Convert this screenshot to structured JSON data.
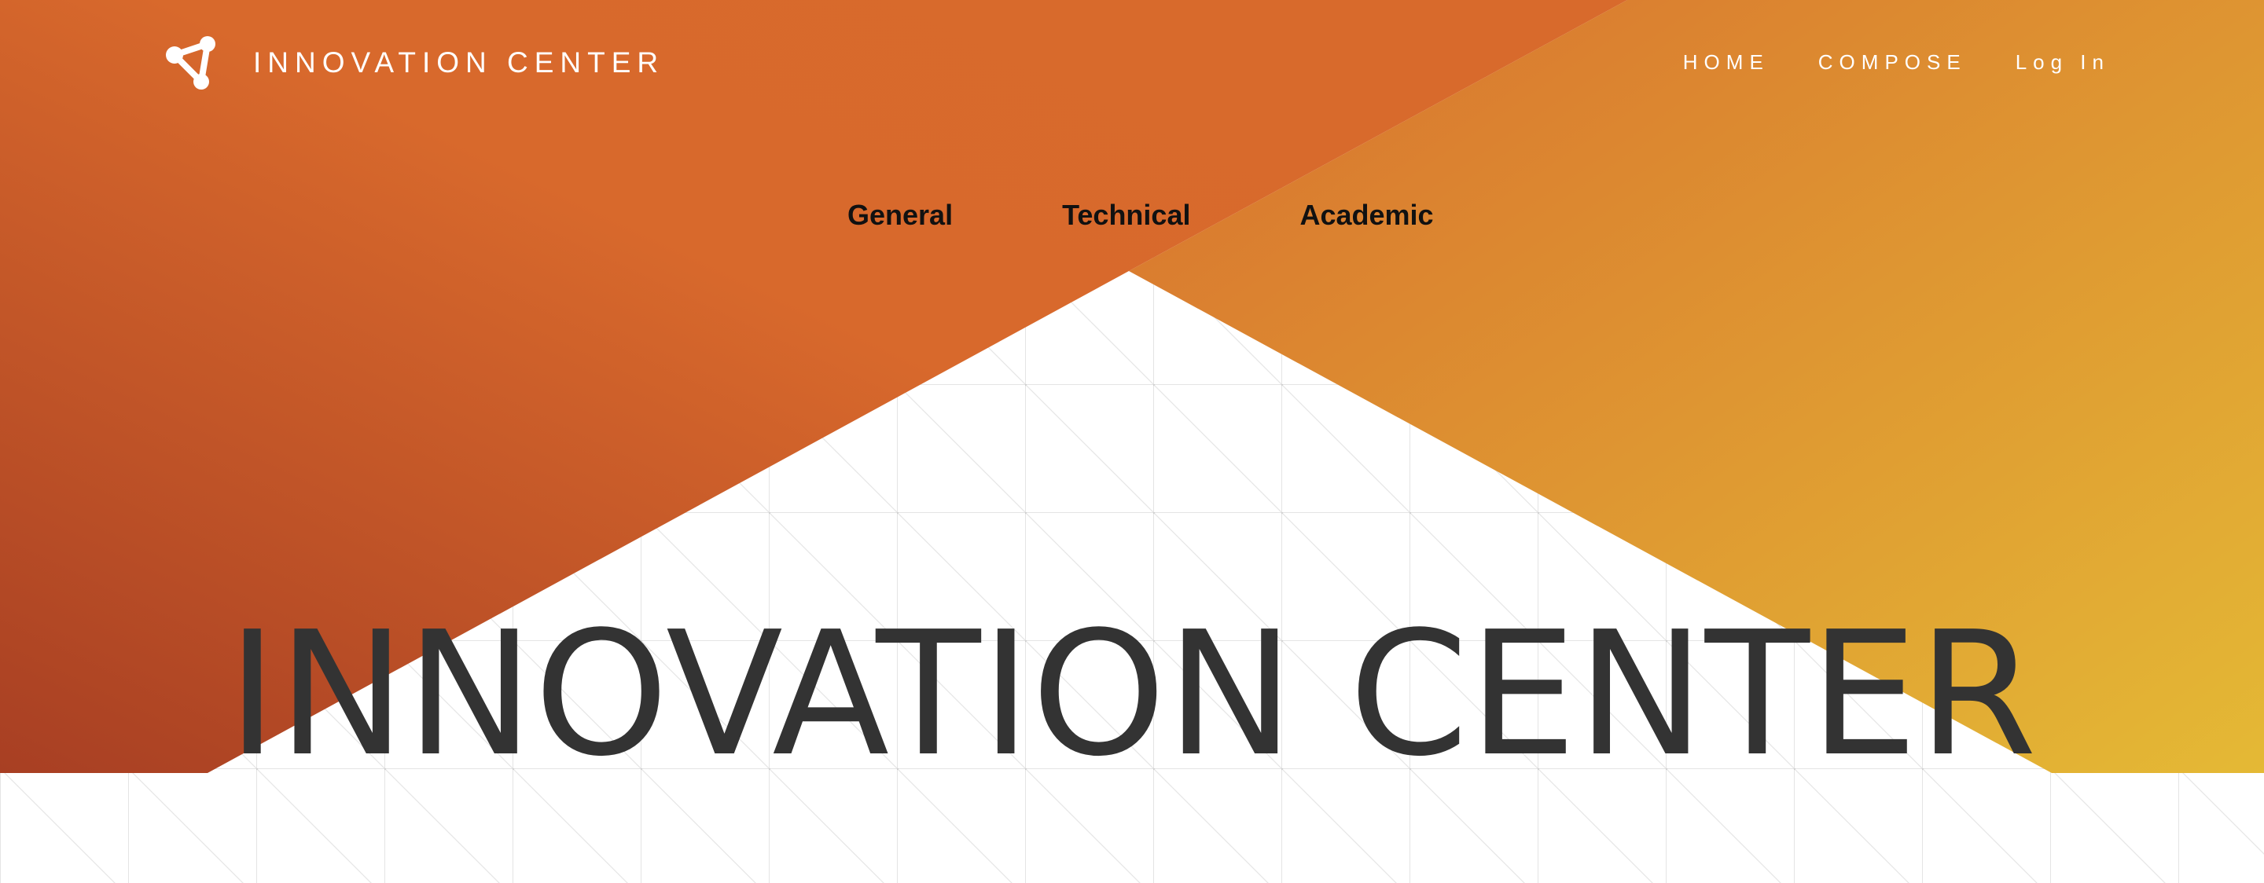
{
  "brand": {
    "name": "INNOVATION CENTER",
    "logo_icon": "network-nodes-icon"
  },
  "top_nav": {
    "items": [
      {
        "label": "HOME"
      },
      {
        "label": "COMPOSE"
      },
      {
        "label": "Log In"
      }
    ]
  },
  "tabs": {
    "items": [
      {
        "label": "General"
      },
      {
        "label": "Technical"
      },
      {
        "label": "Academic"
      }
    ]
  },
  "hero": {
    "title": "INNOVATION CENTER"
  },
  "colors": {
    "gradient_start": "#ad4224",
    "gradient_mid": "#d8692c",
    "gradient_end": "#e3b735",
    "grid_line": "#d8d8d8",
    "hero_text": "#333333",
    "nav_text": "#ffffff",
    "tab_text": "#111111"
  }
}
